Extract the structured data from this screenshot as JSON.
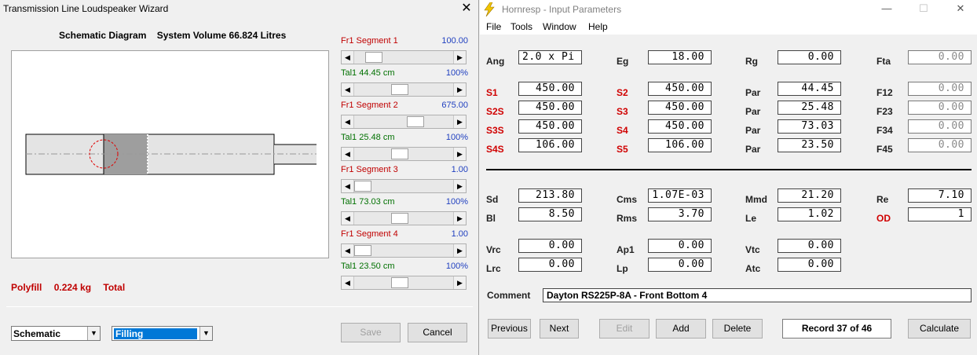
{
  "wizard": {
    "title": "Transmission Line Loudspeaker Wizard",
    "close": "✕",
    "schematic_label": "Schematic Diagram",
    "system_volume": "System Volume 66.824 Litres",
    "sliders": [
      {
        "label": "Fr1  Segment 1",
        "value": "100.00",
        "color": "red",
        "position": 0.13
      },
      {
        "label": "Tal1  44.45 cm",
        "value": "100%",
        "color": "green",
        "position": 0.45
      },
      {
        "label": "Fr1  Segment 2",
        "value": "675.00",
        "color": "red",
        "position": 0.64
      },
      {
        "label": "Tal1  25.48 cm",
        "value": "100%",
        "color": "green",
        "position": 0.45
      },
      {
        "label": "Fr1  Segment 3",
        "value": "1.00",
        "color": "red",
        "position": 0.0
      },
      {
        "label": "Tal1  73.03 cm",
        "value": "100%",
        "color": "green",
        "position": 0.45
      },
      {
        "label": "Fr1  Segment 4",
        "value": "1.00",
        "color": "red",
        "position": 0.0
      },
      {
        "label": "Tal1  23.50 cm",
        "value": "100%",
        "color": "green",
        "position": 0.45
      }
    ],
    "polyfill": {
      "label": "Polyfill",
      "mass": "0.224 kg",
      "scope": "Total"
    },
    "view_select": "Schematic",
    "mode_select": "Filling",
    "save_label": "Save",
    "cancel_label": "Cancel"
  },
  "hornresp": {
    "title": "Hornresp - Input Parameters",
    "minimize": "—",
    "maximize": "☐",
    "close": "✕",
    "menu": [
      "File",
      "Tools",
      "Window",
      "Help"
    ],
    "params_top": [
      {
        "label": "Ang",
        "value": "2.0 x Pi",
        "red": false,
        "disabled": false
      },
      {
        "label": "Eg",
        "value": "18.00",
        "red": false,
        "disabled": false
      },
      {
        "label": "Rg",
        "value": "0.00",
        "red": false,
        "disabled": false
      },
      {
        "label": "Fta",
        "value": "0.00",
        "red": false,
        "disabled": true
      },
      {
        "label": "S1",
        "value": "450.00",
        "red": true,
        "disabled": false
      },
      {
        "label": "S2",
        "value": "450.00",
        "red": true,
        "disabled": false
      },
      {
        "label": "Par",
        "value": "44.45",
        "red": false,
        "disabled": false
      },
      {
        "label": "F12",
        "value": "0.00",
        "red": false,
        "disabled": true
      },
      {
        "label": "S2S",
        "value": "450.00",
        "red": true,
        "disabled": false
      },
      {
        "label": "S3",
        "value": "450.00",
        "red": true,
        "disabled": false
      },
      {
        "label": "Par",
        "value": "25.48",
        "red": false,
        "disabled": false
      },
      {
        "label": "F23",
        "value": "0.00",
        "red": false,
        "disabled": true
      },
      {
        "label": "S3S",
        "value": "450.00",
        "red": true,
        "disabled": false
      },
      {
        "label": "S4",
        "value": "450.00",
        "red": true,
        "disabled": false
      },
      {
        "label": "Par",
        "value": "73.03",
        "red": false,
        "disabled": false
      },
      {
        "label": "F34",
        "value": "0.00",
        "red": false,
        "disabled": true
      },
      {
        "label": "S4S",
        "value": "106.00",
        "red": true,
        "disabled": false
      },
      {
        "label": "S5",
        "value": "106.00",
        "red": true,
        "disabled": false
      },
      {
        "label": "Par",
        "value": "23.50",
        "red": false,
        "disabled": false
      },
      {
        "label": "F45",
        "value": "0.00",
        "red": false,
        "disabled": true
      }
    ],
    "params_driver": [
      {
        "label": "Sd",
        "value": "213.80",
        "red": false,
        "disabled": false
      },
      {
        "label": "Cms",
        "value": "1.07E-03",
        "red": false,
        "disabled": false
      },
      {
        "label": "Mmd",
        "value": "21.20",
        "red": false,
        "disabled": false
      },
      {
        "label": "Re",
        "value": "7.10",
        "red": false,
        "disabled": false
      },
      {
        "label": "Bl",
        "value": "8.50",
        "red": false,
        "disabled": false
      },
      {
        "label": "Rms",
        "value": "3.70",
        "red": false,
        "disabled": false
      },
      {
        "label": "Le",
        "value": "1.02",
        "red": false,
        "disabled": false
      },
      {
        "label": "OD",
        "value": "1",
        "red": true,
        "disabled": false
      },
      {
        "label": "Vrc",
        "value": "0.00",
        "red": false,
        "disabled": false
      },
      {
        "label": "Ap1",
        "value": "0.00",
        "red": false,
        "disabled": false
      },
      {
        "label": "Vtc",
        "value": "0.00",
        "red": false,
        "disabled": false
      },
      {
        "label": "Lrc",
        "value": "0.00",
        "red": false,
        "disabled": false
      },
      {
        "label": "Lp",
        "value": "0.00",
        "red": false,
        "disabled": false
      },
      {
        "label": "Atc",
        "value": "0.00",
        "red": false,
        "disabled": false
      }
    ],
    "comment_label": "Comment",
    "comment_value": "Dayton RS225P-8A - Front Bottom 4",
    "buttons": {
      "previous": "Previous",
      "next": "Next",
      "edit": "Edit",
      "add": "Add",
      "delete": "Delete",
      "record": "Record 37 of 46",
      "calculate": "Calculate"
    }
  }
}
